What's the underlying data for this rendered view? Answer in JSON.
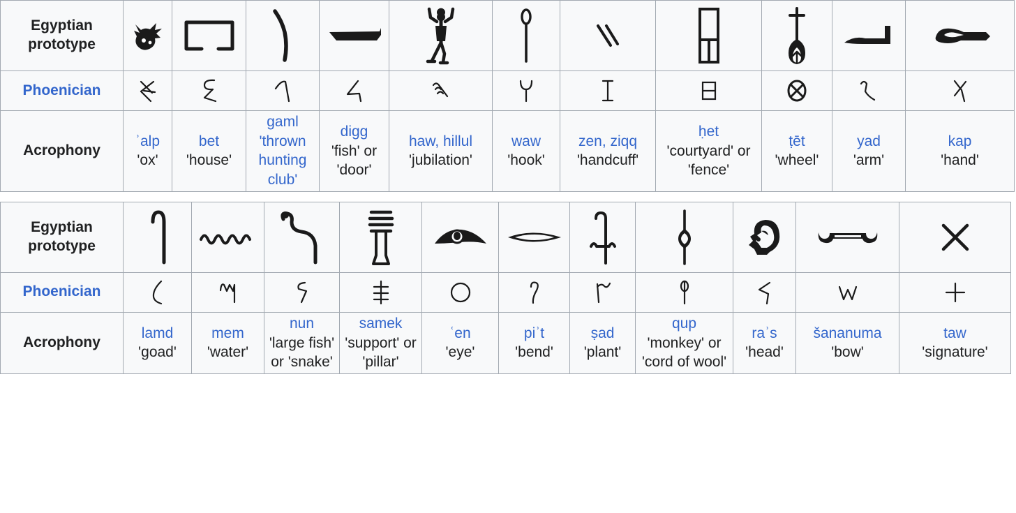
{
  "tables": [
    {
      "rows": {
        "egyptian_label": "Egyptian prototype",
        "phoenician_label": "Phoenician",
        "acrophony_label": "Acrophony"
      },
      "columns": [
        {
          "egyptian_icon": "ox-head-hieroglyph",
          "phoenician_icon": "phoenician-aleph",
          "name": "ʾalp",
          "meaning": "'ox'"
        },
        {
          "egyptian_icon": "house-plan-hieroglyph",
          "phoenician_icon": "phoenician-bet",
          "name": "bet",
          "meaning": "'house'"
        },
        {
          "egyptian_icon": "throwstick-hieroglyph",
          "phoenician_icon": "phoenician-gimel",
          "name": "gaml",
          "meaning": "'thrown hunting club'",
          "name_color": "link",
          "meaning_color": "link"
        },
        {
          "egyptian_icon": "fish-door-hieroglyph",
          "phoenician_icon": "phoenician-dalet",
          "name": "digg",
          "meaning": "'fish' or 'door'"
        },
        {
          "egyptian_icon": "jubilating-man-hieroglyph",
          "phoenician_icon": "phoenician-he",
          "name": "haw, hillul",
          "meaning": "'jubilation'"
        },
        {
          "egyptian_icon": "mace-hook-hieroglyph",
          "phoenician_icon": "phoenician-waw",
          "name": "waw",
          "meaning": "'hook'"
        },
        {
          "egyptian_icon": "two-strokes-hieroglyph",
          "phoenician_icon": "phoenician-zayin",
          "name": "zen, ziqq",
          "meaning": "'handcuff'"
        },
        {
          "egyptian_icon": "courtyard-hieroglyph",
          "phoenician_icon": "phoenician-het",
          "name": "ḥet",
          "meaning": "'courtyard' or 'fence'"
        },
        {
          "egyptian_icon": "spindle-hieroglyph",
          "phoenician_icon": "phoenician-tet",
          "name": "ṭēt",
          "meaning": "'wheel'"
        },
        {
          "egyptian_icon": "arm-hieroglyph",
          "phoenician_icon": "phoenician-yod",
          "name": "yad",
          "meaning": "'arm'"
        },
        {
          "egyptian_icon": "hand-hieroglyph",
          "phoenician_icon": "phoenician-kaf",
          "name": "kap",
          "meaning": "'hand'"
        }
      ]
    },
    {
      "rows": {
        "egyptian_label": "Egyptian prototype",
        "phoenician_label": "Phoenician",
        "acrophony_label": "Acrophony"
      },
      "columns": [
        {
          "egyptian_icon": "shepherds-crook-hieroglyph",
          "phoenician_icon": "phoenician-lamed",
          "name": "lamd",
          "meaning": "'goad'"
        },
        {
          "egyptian_icon": "water-ripple-hieroglyph",
          "phoenician_icon": "phoenician-mem",
          "name": "mem",
          "meaning": "'water'"
        },
        {
          "egyptian_icon": "cobra-hieroglyph",
          "phoenician_icon": "phoenician-nun",
          "name": "nun",
          "meaning": "'large fish' or 'snake'"
        },
        {
          "egyptian_icon": "djed-pillar-hieroglyph",
          "phoenician_icon": "phoenician-samek",
          "name": "samek",
          "meaning": "'support' or 'pillar'"
        },
        {
          "egyptian_icon": "eye-hieroglyph",
          "phoenician_icon": "phoenician-ayin",
          "name": "ʿen",
          "meaning": "'eye'"
        },
        {
          "egyptian_icon": "mouth-hieroglyph",
          "phoenician_icon": "phoenician-pe",
          "name": "piʾt",
          "meaning": "'bend'"
        },
        {
          "egyptian_icon": "plant-hieroglyph",
          "phoenician_icon": "phoenician-sade",
          "name": "ṣad",
          "meaning": "'plant'"
        },
        {
          "egyptian_icon": "cord-of-wool-hieroglyph",
          "phoenician_icon": "phoenician-qof",
          "name": "qup",
          "meaning": "'monkey' or 'cord of wool'"
        },
        {
          "egyptian_icon": "head-hieroglyph",
          "phoenician_icon": "phoenician-resh",
          "name": "raʾs",
          "meaning": "'head'"
        },
        {
          "egyptian_icon": "bow-hieroglyph",
          "phoenician_icon": "phoenician-shin",
          "name": "šananuma",
          "meaning": "'bow'"
        },
        {
          "egyptian_icon": "cross-mark-hieroglyph",
          "phoenician_icon": "phoenician-taw",
          "name": "taw",
          "meaning": "'signature'"
        }
      ]
    }
  ],
  "colors": {
    "link": "#3366cc",
    "text": "#202122",
    "header_bg": "#eaecf0",
    "cell_bg": "#f8f9fa",
    "border": "#a2a9b1"
  }
}
